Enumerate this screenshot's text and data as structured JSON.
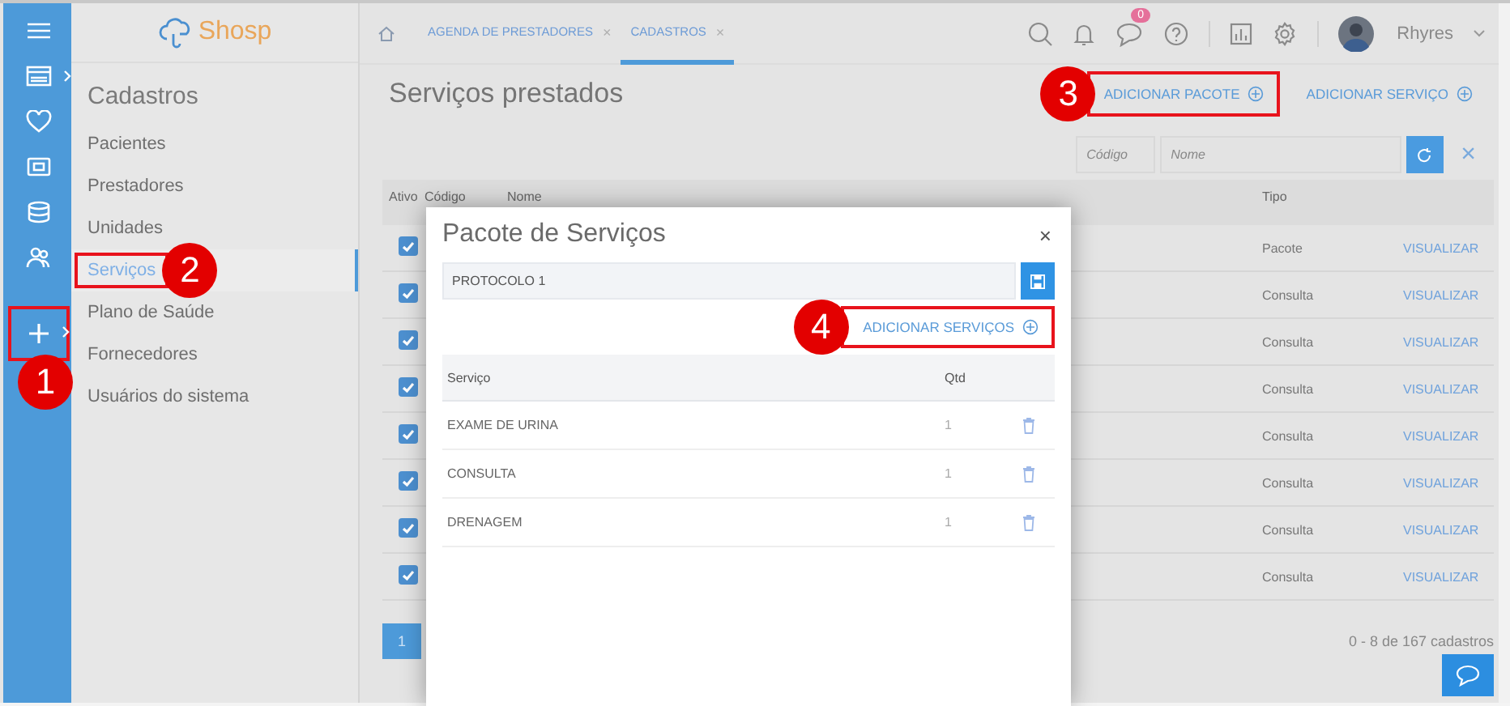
{
  "rail": {
    "items": [
      {
        "kind": "menu",
        "expandable": false
      },
      {
        "kind": "calendar",
        "expandable": true
      },
      {
        "kind": "heart",
        "expandable": false
      },
      {
        "kind": "cash",
        "expandable": false
      },
      {
        "kind": "database",
        "expandable": false
      },
      {
        "kind": "people",
        "expandable": false
      },
      {
        "kind": "add",
        "expandable": true,
        "annotation": "1"
      }
    ]
  },
  "sidebar": {
    "logo": "Shosp",
    "heading": "Cadastros",
    "items": [
      {
        "label": "Pacientes",
        "selected": false
      },
      {
        "label": "Prestadores",
        "selected": false
      },
      {
        "label": "Unidades",
        "selected": false
      },
      {
        "label": "Serviços",
        "selected": true,
        "annotation": "2"
      },
      {
        "label": "Plano de Saúde",
        "selected": false
      },
      {
        "label": "Fornecedores",
        "selected": false
      },
      {
        "label": "Usuários do sistema",
        "selected": false
      }
    ]
  },
  "topbar": {
    "tabs": [
      {
        "label": "AGENDA DE PRESTADORES",
        "close": "×",
        "selected": false
      },
      {
        "label": "CADASTROS",
        "close": "×",
        "selected": true
      }
    ],
    "notification_count": "0",
    "user": "Rhyres"
  },
  "page": {
    "title": "Serviços prestados",
    "actions": [
      {
        "label": "ADICIONAR PACOTE",
        "annotation": "3"
      },
      {
        "label": "ADICIONAR SERVIÇO"
      }
    ],
    "filters": [
      {
        "placeholder": "Código"
      },
      {
        "placeholder": "Nome"
      }
    ],
    "clear": "×",
    "table": {
      "columns": [
        "Ativo",
        "Código",
        "Nome",
        "Tipo"
      ],
      "rows": [
        {
          "checked": true,
          "tipo": "Pacote",
          "action": "VISUALIZAR"
        },
        {
          "checked": true,
          "tipo": "Consulta",
          "action": "VISUALIZAR"
        },
        {
          "checked": true,
          "tipo": "Consulta",
          "action": "VISUALIZAR"
        },
        {
          "checked": true,
          "tipo": "Consulta",
          "action": "VISUALIZAR"
        },
        {
          "checked": true,
          "tipo": "Consulta",
          "action": "VISUALIZAR"
        },
        {
          "checked": true,
          "tipo": "Consulta",
          "action": "VISUALIZAR"
        },
        {
          "checked": true,
          "tipo": "Consulta",
          "action": "VISUALIZAR"
        },
        {
          "checked": true,
          "tipo": "Consulta",
          "action": "VISUALIZAR"
        }
      ]
    },
    "pagination": {
      "pages": [
        {
          "label": "1",
          "selected": true
        }
      ],
      "summary": "0 - 8 de 167 cadastros"
    }
  },
  "modal": {
    "title": "Pacote de Serviços",
    "close": "×",
    "name_value": "PROTOCOLO 1",
    "add_link": {
      "label": "ADICIONAR SERVIÇOS",
      "annotation": "4"
    },
    "columns": [
      "Serviço",
      "Qtd"
    ],
    "rows": [
      {
        "servico": "EXAME DE URINA",
        "qtd": "1"
      },
      {
        "servico": "CONSULTA",
        "qtd": "1"
      },
      {
        "servico": "DRENAGEM",
        "qtd": "1"
      }
    ]
  }
}
